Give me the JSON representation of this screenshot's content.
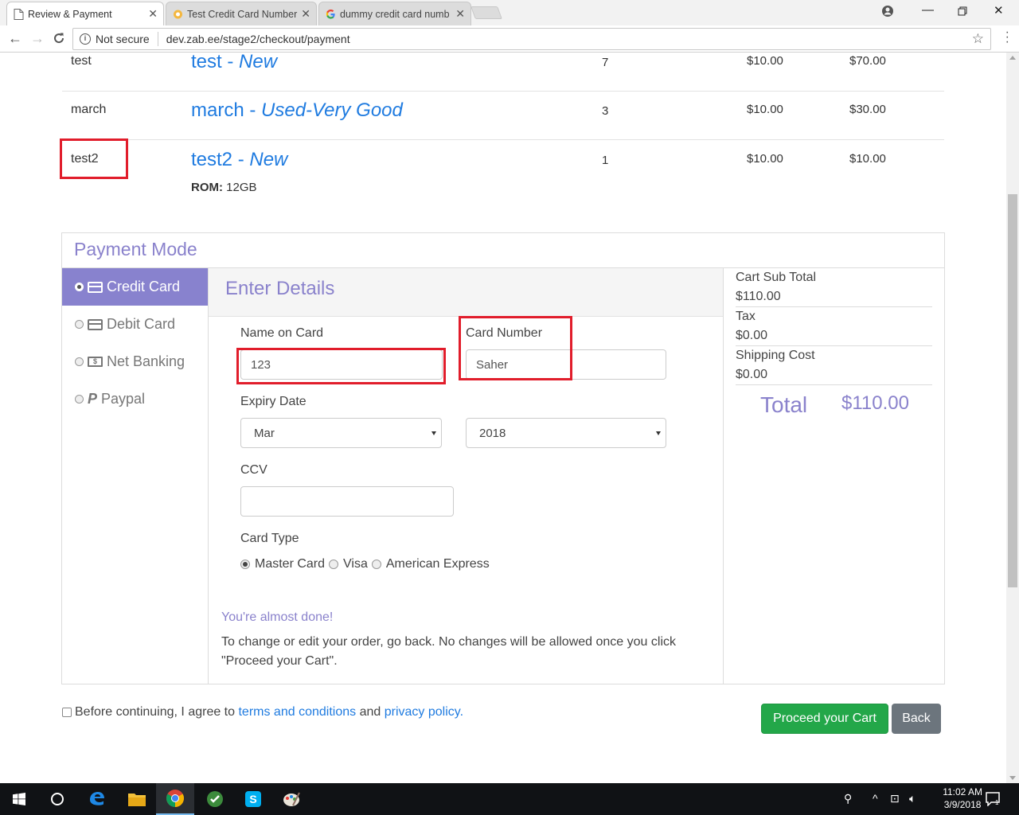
{
  "browser": {
    "tabs": [
      {
        "label": "Review & Payment",
        "icon": "page-icon",
        "active": true
      },
      {
        "label": "Test Credit Card Number",
        "icon": "favicon-icon",
        "active": false
      },
      {
        "label": "dummy credit card numb",
        "icon": "google-icon",
        "active": false
      }
    ],
    "address": {
      "security": "Not secure",
      "url": "dev.zab.ee/stage2/checkout/payment"
    }
  },
  "products": [
    {
      "image_alt": "test",
      "name": "test",
      "condition": "New",
      "qty": "7",
      "price": "$10.00",
      "total": "$70.00"
    },
    {
      "image_alt": "march",
      "name": "march",
      "condition": "Used-Very Good",
      "qty": "3",
      "price": "$10.00",
      "total": "$30.00"
    },
    {
      "image_alt": "test2",
      "name": "test2",
      "condition": "New",
      "qty": "1",
      "price": "$10.00",
      "total": "$10.00",
      "spec_label": "ROM:",
      "spec_value": "12GB"
    }
  ],
  "separator": " - ",
  "payment": {
    "heading": "Payment Mode",
    "modes": [
      {
        "label": "Credit Card",
        "icon": "credit-card-icon",
        "selected": true
      },
      {
        "label": "Debit Card",
        "icon": "debit-card-icon",
        "selected": false
      },
      {
        "label": "Net Banking",
        "icon": "banknote-icon",
        "selected": false
      },
      {
        "label": "Paypal",
        "icon": "paypal-icon",
        "selected": false
      }
    ],
    "details_heading": "Enter Details",
    "form": {
      "name_label": "Name on Card",
      "name_value": "123",
      "number_label": "Card Number",
      "number_value": "Saher",
      "expiry_label": "Expiry Date",
      "expiry_month": "Mar",
      "expiry_year": "2018",
      "ccv_label": "CCV",
      "ccv_value": "",
      "card_type_label": "Card Type",
      "card_types": [
        "Master Card",
        "Visa",
        "American Express"
      ],
      "card_type_selected": "Master Card"
    },
    "almost_done": "You're almost done!",
    "notice": "To change or edit your order, go back. No changes will be allowed once you click \"Proceed your Cart\"."
  },
  "summary": {
    "subtotal_label": "Cart Sub Total",
    "subtotal_value": "$110.00",
    "tax_label": "Tax",
    "tax_value": "$0.00",
    "shipping_label": "Shipping Cost",
    "shipping_value": "$0.00",
    "total_label": "Total",
    "total_value": "$110.00"
  },
  "footer": {
    "agree_prefix": "Before continuing, I agree to",
    "terms_link": "terms and conditions",
    "and_text": "and",
    "privacy_link": "privacy policy.",
    "proceed_button": "Proceed your Cart",
    "back_button": "Back"
  },
  "taskbar": {
    "time": "11:02 AM",
    "date": "3/9/2018"
  },
  "colors": {
    "accent_purple": "#8882ce",
    "link_blue": "#1f7be0",
    "proceed_green": "#23a749",
    "back_gray": "#6c757d",
    "annotation_red": "#e11d2b"
  }
}
